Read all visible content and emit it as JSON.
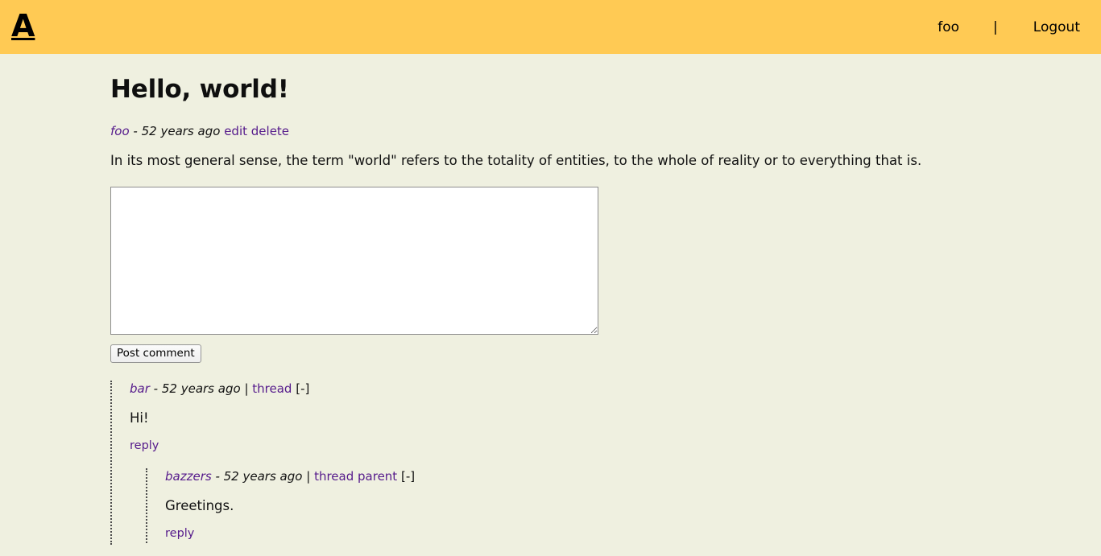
{
  "header": {
    "brand": "A",
    "nav": {
      "user": "foo",
      "separator": "|",
      "logout": "Logout"
    }
  },
  "post": {
    "title": "Hello, world!",
    "author": "foo",
    "timestamp": "- 52 years ago",
    "edit_label": "edit",
    "delete_label": "delete",
    "body": "In its most general sense, the term \"world\" refers to the totality of entities, to the whole of reality or to everything that is."
  },
  "comment_form": {
    "value": "",
    "placeholder": "",
    "submit_label": "Post comment"
  },
  "comments": [
    {
      "author": "bar",
      "timestamp": "- 52 years ago",
      "pipe": "|",
      "thread_label": "thread",
      "collapse_label": "[-]",
      "text": "Hi!",
      "reply_label": "reply",
      "children": [
        {
          "author": "bazzers",
          "timestamp": "- 52 years ago",
          "pipe": "|",
          "thread_label": "thread",
          "parent_label": "parent",
          "collapse_label": "[-]",
          "text": "Greetings.",
          "reply_label": "reply"
        }
      ]
    }
  ],
  "colors": {
    "header_background": "#ffca54",
    "page_background": "#eff0e0",
    "link": "#551a8b",
    "text": "#111111"
  }
}
